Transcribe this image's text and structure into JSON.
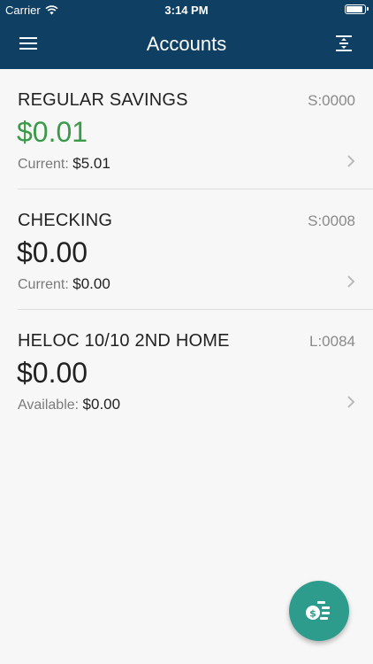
{
  "status_bar": {
    "carrier": "Carrier",
    "time": "3:14 PM",
    "icons": [
      "wifi-icon",
      "battery-icon"
    ]
  },
  "nav": {
    "title": "Accounts",
    "left_icon": "menu-icon",
    "right_icon": "reorder-icon"
  },
  "accounts": [
    {
      "name": "REGULAR SAVINGS",
      "number": "S:0000",
      "balance": "$0.01",
      "sub_label": "Current:",
      "sub_value": "$5.01"
    },
    {
      "name": "CHECKING",
      "number": "S:0008",
      "balance": "$0.00",
      "sub_label": "Current:",
      "sub_value": "$0.00"
    },
    {
      "name": "HELOC 10/10 2ND HOME",
      "number": "L:0084",
      "balance": "$0.00",
      "sub_label": "Available:",
      "sub_value": "$0.00"
    }
  ],
  "fab": {
    "icon": "money-transfer-icon"
  },
  "colors": {
    "header": "#0f3f63",
    "positive_balance": "#3a9a48",
    "fab": "#2e9c8c",
    "background": "#f7f7f7"
  }
}
